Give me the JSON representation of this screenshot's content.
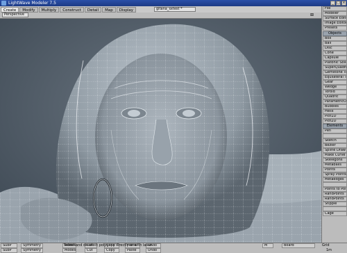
{
  "window": {
    "title": "LightWave Modeler 7.5",
    "min_label": "_",
    "max_label": "□",
    "close_label": "x"
  },
  "tabs": [
    "Create",
    "Modify",
    "Multiply",
    "Construct",
    "Detail",
    "Map",
    "Display"
  ],
  "tab_active_index": 0,
  "object_dropdown": "gitana_sxtest *",
  "view": {
    "mode": "Perspective"
  },
  "right_menu": {
    "top": [
      "File",
      "Modeler",
      "Surface Editor",
      "Image Editor",
      "Presets"
    ],
    "objects_header": "Objects",
    "objects": [
      "Box",
      "Ball",
      "Disc",
      "Cone",
      "Capsule",
      "Platonic Solid",
      "SuperQuadric",
      "Gemstone Tool",
      "Equilateral Tri",
      "Gear",
      "Wedge",
      "Toroid",
      "Quadric",
      "ParametricObj",
      "Bubbles",
      "Helix",
      "Plot1D",
      "Plot2D"
    ],
    "elements_header": "Elements",
    "elements": [
      "Pen",
      "",
      "Sketch",
      "Bezier",
      "Spline Draw",
      "Make Curve",
      "Skelegons",
      "Metaballs",
      "Points",
      "Spray Points",
      "Metaedges",
      "",
      "Points to Polys",
      "RandPoints",
      "RandPoints",
      "Stipple",
      "",
      "Cage"
    ]
  },
  "statusbar": {
    "row1_left": [
      "SubP",
      "Symmetry",
      "Modes",
      "Cut",
      "Copy",
      "Paste",
      "Undo"
    ],
    "help_text": "Select and deselect polygons directly or with lasso.",
    "row1_right": [
      "M",
      "Board"
    ],
    "row2_left": [
      "SubP",
      "Symmetry",
      "Modes",
      "Cut",
      "Copy",
      "Paste",
      "Undo"
    ],
    "grid_label": "Grid",
    "grid_value": "1m"
  },
  "colors": {
    "titlebar": "#1c3a85",
    "panel": "#bcbcbc",
    "viewport": "#55616c",
    "wire": "#e8eef3"
  }
}
